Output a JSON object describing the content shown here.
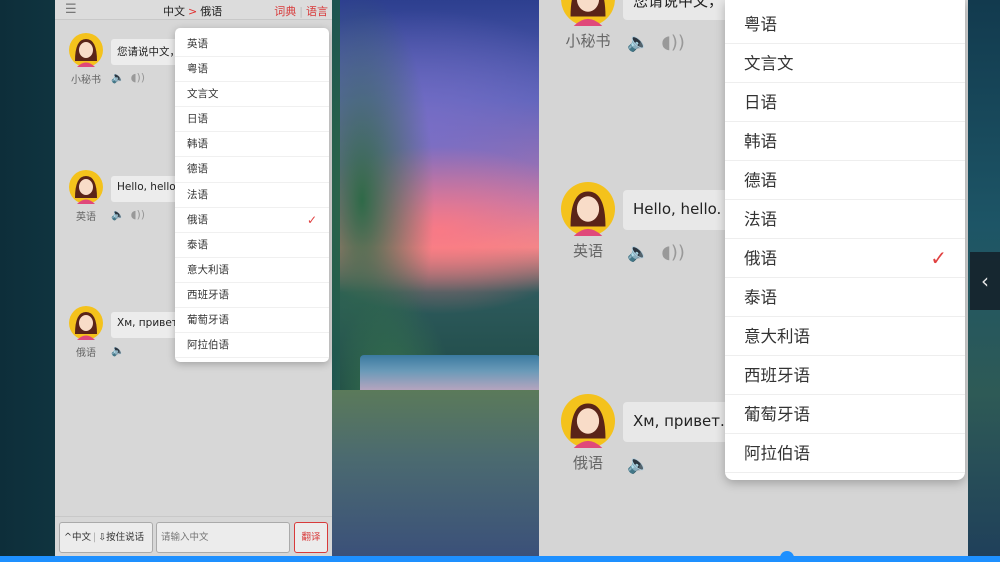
{
  "small_panel": {
    "header": {
      "menu_icon": "hamburger-icon",
      "source_lang": "中文",
      "arrow": ">",
      "target_lang": "俄语",
      "link_dictionary": "词典",
      "link_language": "语言"
    },
    "messages": [
      {
        "name": "小秘书",
        "text": "您请说中文，"
      },
      {
        "name": "英语",
        "text": "Hello, hello."
      },
      {
        "name": "俄语",
        "text": "Хм, привет."
      }
    ],
    "footer": {
      "lang_toggle": "中文",
      "hold_to_talk": "按住说话",
      "input_placeholder": "请输入中文",
      "translate_button": "翻译"
    }
  },
  "large_panel": {
    "messages": [
      {
        "name": "小秘书",
        "text": "您请说中文，"
      },
      {
        "name": "英语",
        "text": "Hello, hello."
      },
      {
        "name": "俄语",
        "text": "Хм, привет."
      }
    ]
  },
  "languages": {
    "full_list": [
      "英语",
      "粤语",
      "文言文",
      "日语",
      "韩语",
      "德语",
      "法语",
      "俄语",
      "泰语",
      "意大利语",
      "西班牙语",
      "葡萄牙语",
      "阿拉伯语"
    ],
    "large_visible_list": [
      "粤语",
      "文言文",
      "日语",
      "韩语",
      "德语",
      "法语",
      "俄语",
      "泰语",
      "意大利语",
      "西班牙语",
      "葡萄牙语",
      "阿拉伯语"
    ],
    "selected": "俄语"
  },
  "colors": {
    "accent_red": "#d83a3a",
    "check_red": "#e04040",
    "progress_blue": "#1e90ff",
    "panel_bg": "#d7d7d7"
  },
  "icons": {
    "speaker": "speaker-icon",
    "play": "play-sound-icon",
    "check": "checkmark-icon",
    "side_collapse": "chevron-left-icon"
  }
}
